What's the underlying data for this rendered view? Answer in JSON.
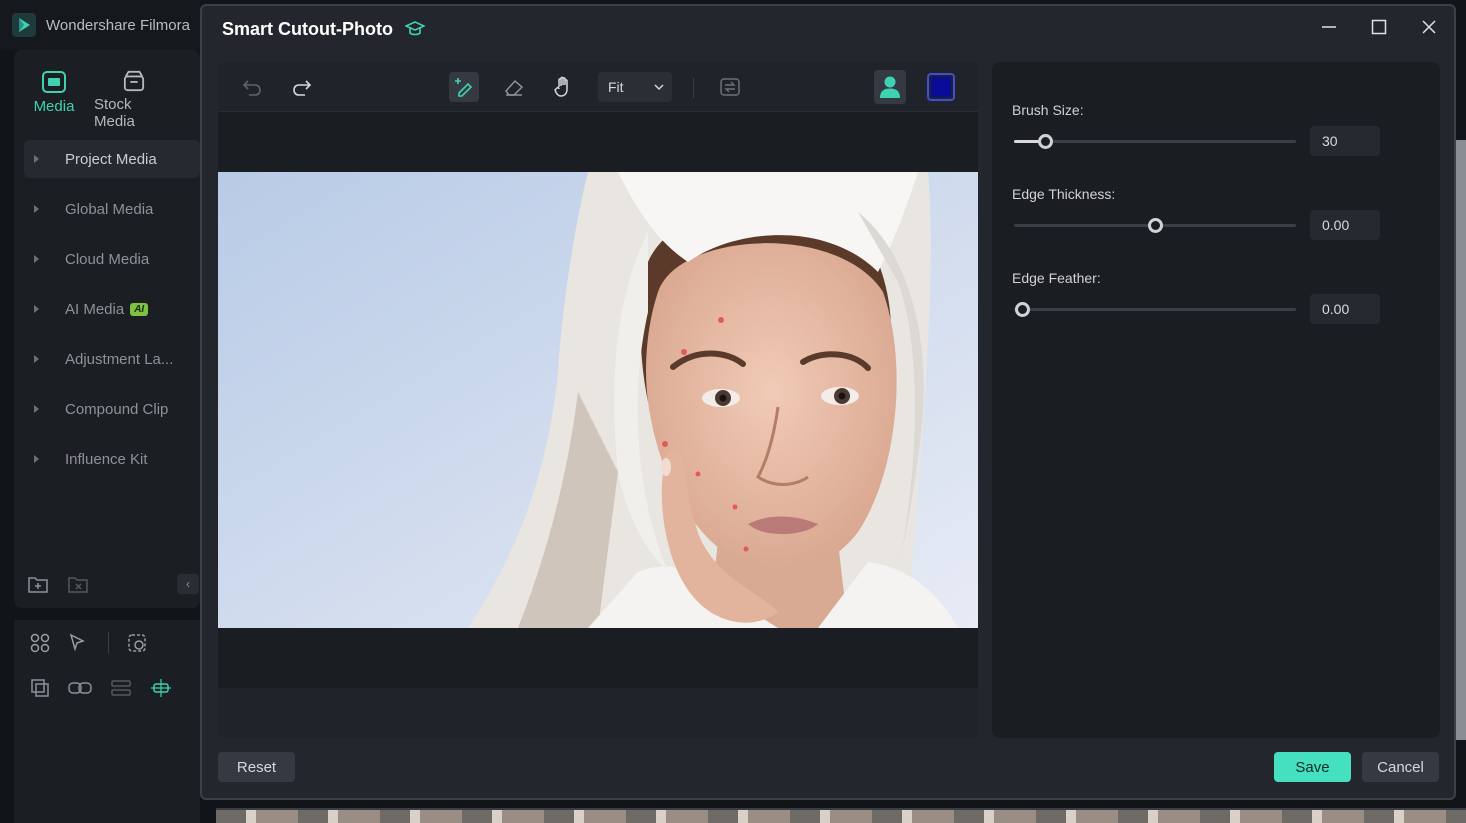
{
  "app": {
    "title": "Wondershare Filmora"
  },
  "left_panel": {
    "tabs": [
      {
        "label": "Media"
      },
      {
        "label": "Stock Media"
      }
    ],
    "items": [
      {
        "label": "Project Media"
      },
      {
        "label": "Global Media"
      },
      {
        "label": "Cloud Media"
      },
      {
        "label": "AI Media",
        "badge": "AI"
      },
      {
        "label": "Adjustment La..."
      },
      {
        "label": "Compound Clip"
      },
      {
        "label": "Influence Kit"
      }
    ]
  },
  "dialog": {
    "title": "Smart Cutout-Photo",
    "toolbar": {
      "zoom": "Fit",
      "mask_color": "#0b0b9a"
    },
    "properties": {
      "brush_size": {
        "label": "Brush Size:",
        "value": "30",
        "fraction": 0.11
      },
      "edge_thickness": {
        "label": "Edge Thickness:",
        "value": "0.00",
        "fraction": 0.5
      },
      "edge_feather": {
        "label": "Edge Feather:",
        "value": "0.00",
        "fraction": 0.03
      }
    },
    "buttons": {
      "reset": "Reset",
      "save": "Save",
      "cancel": "Cancel"
    }
  },
  "colors": {
    "accent": "#44e0c0"
  }
}
